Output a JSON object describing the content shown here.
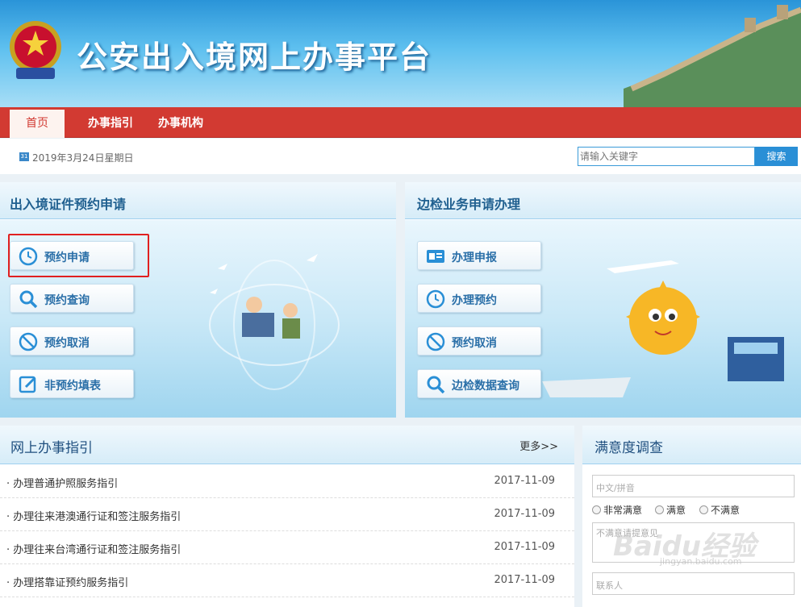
{
  "banner": {
    "title": "公安出入境网上办事平台"
  },
  "nav": {
    "items": [
      "首页",
      "办事指引",
      "办事机构"
    ]
  },
  "datebar": {
    "date": "2019年3月24日星期日",
    "calendar_icon_text": "31",
    "search_placeholder": "请输入关键字",
    "search_button": "搜索"
  },
  "panel_left": {
    "title": "出入境证件预约申请",
    "buttons": [
      "预约申请",
      "预约查询",
      "预约取消",
      "非预约填表"
    ]
  },
  "panel_right": {
    "title": "边检业务申请办理",
    "buttons": [
      "办理申报",
      "办理预约",
      "预约取消",
      "边检数据查询"
    ]
  },
  "guide": {
    "title": "网上办事指引",
    "more": "更多>>",
    "items": [
      {
        "title": "· 办理普通护照服务指引",
        "date": "2017-11-09"
      },
      {
        "title": "· 办理往来港澳通行证和签注服务指引",
        "date": "2017-11-09"
      },
      {
        "title": "· 办理往来台湾通行证和签注服务指引",
        "date": "2017-11-09"
      },
      {
        "title": "· 办理搭靠证预约服务指引",
        "date": "2017-11-09"
      }
    ]
  },
  "survey": {
    "title": "满意度调查",
    "name_placeholder": "中文/拼音",
    "options": [
      "非常满意",
      "满意",
      "不满意"
    ],
    "opinion_placeholder": "不满意请提意见",
    "contact_placeholder": "联系人"
  },
  "watermark": {
    "text": "Baidu经验",
    "sub": "jingyan.baidu.com"
  },
  "colors": {
    "nav_red": "#d23a32",
    "accent_blue": "#2a8fd6",
    "title_blue": "#1f5f8f",
    "highlight_red": "#e02020"
  }
}
